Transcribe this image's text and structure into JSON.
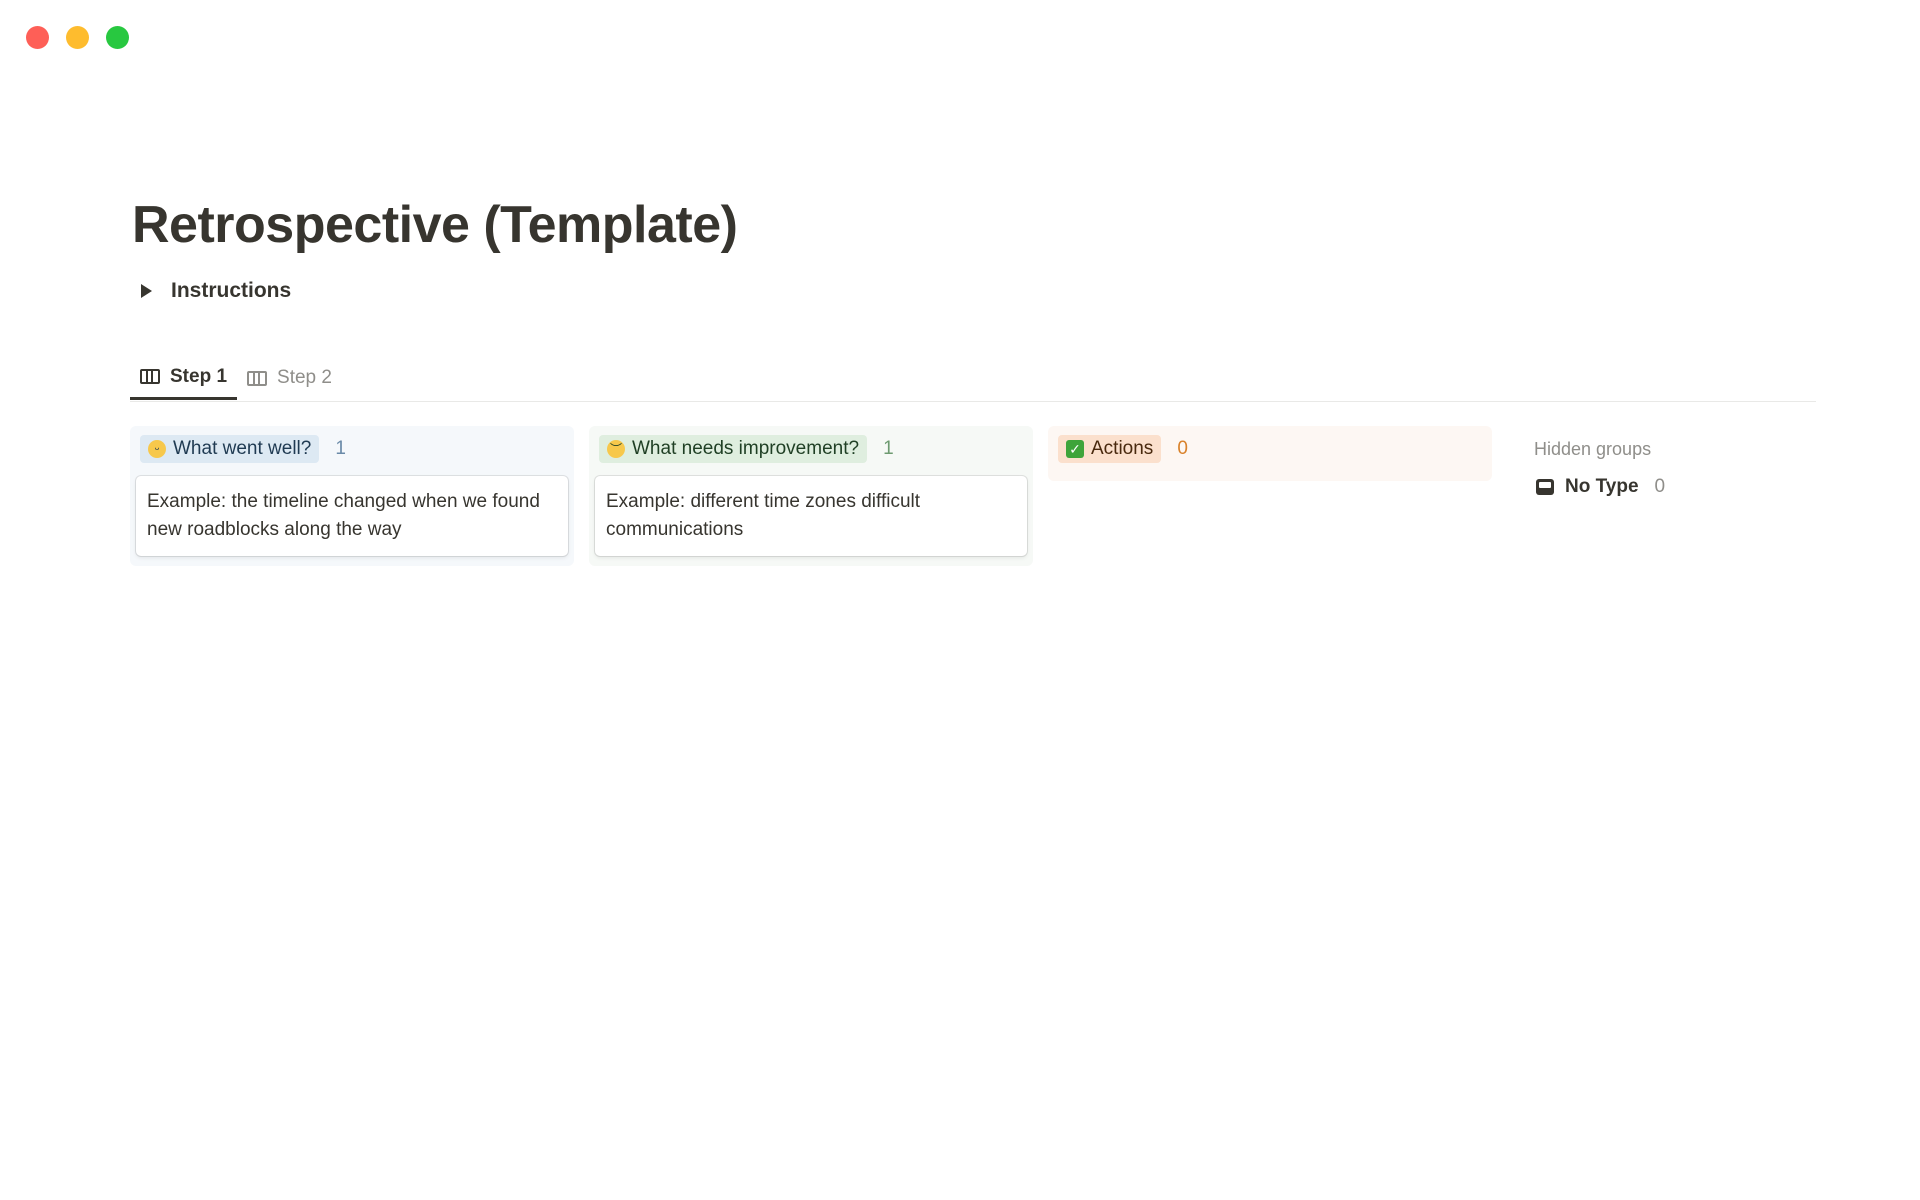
{
  "window": {
    "controls": [
      "close",
      "minimize",
      "zoom"
    ]
  },
  "page": {
    "title": "Retrospective (Template)",
    "toggle_label": "Instructions"
  },
  "tabs": [
    {
      "label": "Step 1",
      "icon": "board-icon",
      "active": true
    },
    {
      "label": "Step 2",
      "icon": "board-icon",
      "active": false
    }
  ],
  "columns": [
    {
      "label": "What went well?",
      "icon": "grinning-face-emoji",
      "count": "1",
      "color": "#dde9f3",
      "cards": [
        "Example: the timeline changed when we found new roadblocks along the way"
      ]
    },
    {
      "label": "What needs improvement?",
      "icon": "disappointed-face-emoji",
      "count": "1",
      "color": "#dfeedf",
      "cards": [
        "Example: different time zones difficult communications"
      ]
    },
    {
      "label": "Actions",
      "icon": "check-mark-button-emoji",
      "count": "0",
      "color": "#fbe0cd",
      "cards": []
    }
  ],
  "hidden_groups": {
    "title": "Hidden groups",
    "items": [
      {
        "label": "No Type",
        "icon": "inbox-icon",
        "count": "0"
      }
    ]
  }
}
